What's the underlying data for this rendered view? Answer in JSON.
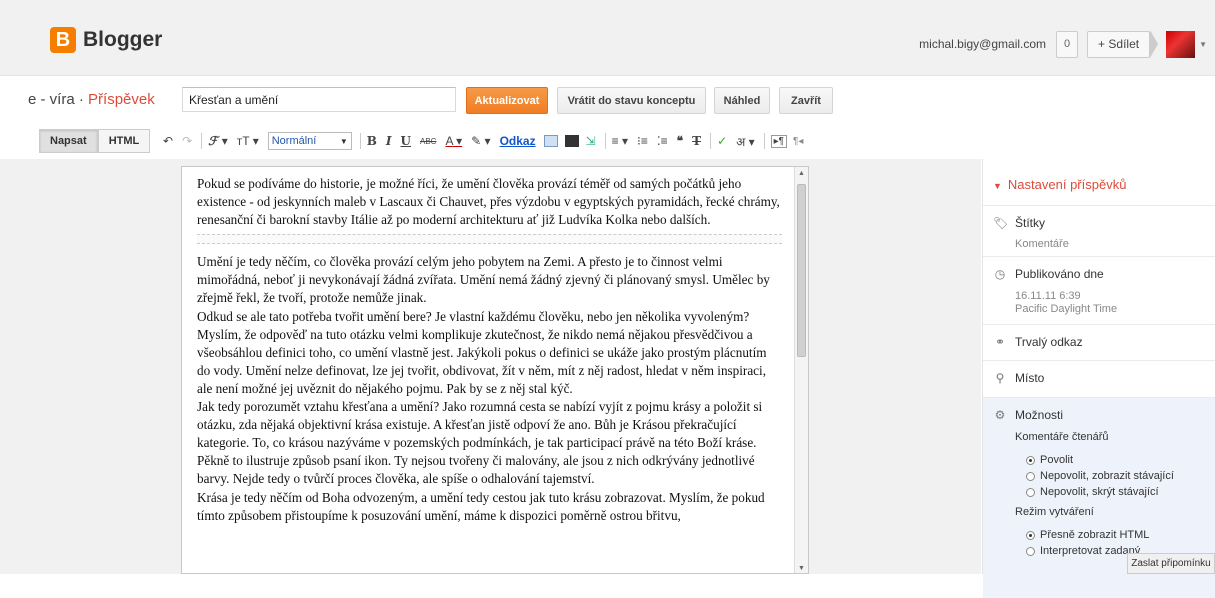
{
  "app": {
    "name": "Blogger",
    "logo_letter": "B",
    "brand_color": "#f57d00"
  },
  "account": {
    "email": "michal.bigy@gmail.com",
    "count": "0",
    "share_label": "+ Sdílet"
  },
  "titlebar": {
    "blog_name": "e - víra",
    "separator": "·",
    "section": "Příspěvek",
    "post_title": "Křesťan a umění",
    "publish_label": "Aktualizovat",
    "draft_label": "Vrátit do stavu konceptu",
    "preview_label": "Náhled",
    "close_label": "Zavřít"
  },
  "toolbar": {
    "compose_label": "Napsat",
    "html_label": "HTML",
    "font_size_value": "Normální",
    "link_label": "Odkaz"
  },
  "editor": {
    "intro": "Pokud se podíváme do historie, je možné říci, že umění člověka provází téměř od samých počátků jeho existence - od jeskynních maleb v Lascaux či Chauvet, přes výzdobu v egyptských pyramidách, řecké chrámy, renesanční či barokní stavby Itálie až po moderní architekturu ať již Ludvíka Kolka nebo dalších.",
    "p1": "Umění je tedy něčím, co člověka provází celým jeho pobytem na Zemi. A přesto je to činnost velmi mimořádná, neboť ji nevykonávají žádná zvířata. Umění nemá žádný zjevný či plánovaný smysl. Umělec by zřejmě řekl, že tvoří, protože nemůže jinak.",
    "p2": "Odkud se ale tato potřeba tvořit umění bere? Je vlastní každému člověku, nebo jen několika vyvoleným? Myslím, že odpověď na tuto otázku velmi komplikuje zkutečnost, že nikdo nemá nějakou přesvědčivou a všeobsáhlou definici toho, co umění vlastně jest. Jakýkoli pokus o definici se ukáže jako prostým plácnutím do vody. Umění nelze definovat, lze jej tvořit, obdivovat, žít v něm, mít z něj radost, hledat v něm inspiraci, ale není možné jej uvěznit do nějakého pojmu. Pak by se z něj stal kýč.",
    "p3": "Jak tedy porozumět vztahu křesťana a umění? Jako rozumná cesta se nabízí vyjít z pojmu krásy a položit si otázku, zda nějaká objektivní krása existuje. A křesťan jistě odpoví že ano. Bůh je Krásou překračující kategorie. To, co krásou nazýváme v pozemských podmínkách, je tak participací právě na této Boží kráse. Pěkně to ilustruje způsob psaní ikon. Ty nejsou tvořeny či malovány, ale jsou z nich odkrývány jednotlivé barvy. Nejde tedy o tvůrčí proces člověka, ale spíše o odhalování tajemství.",
    "p4": "Krása je tedy něčím od Boha odvozeným, a umění tedy cestou jak tuto krásu zobrazovat. Myslím, že pokud tímto způsobem přistoupíme k posuzování umění, máme k dispozici poměrně ostrou břitvu,"
  },
  "sidebar": {
    "heading": "Nastavení příspěvků",
    "labels_title": "Štítky",
    "labels_value": "Komentáře",
    "published_title": "Publikováno dne",
    "published_date": "16.11.11 6:39",
    "published_tz": "Pacific Daylight Time",
    "permalink_title": "Trvalý odkaz",
    "location_title": "Místo",
    "options_title": "Možnosti",
    "reader_comments": "Komentáře čtenářů",
    "comment_options": [
      "Povolit",
      "Nepovolit, zobrazit stávající",
      "Nepovolit, skrýt stávající"
    ],
    "compose_mode": "Režim vytváření",
    "compose_options": [
      "Přesně zobrazit HTML",
      "Interpretovat zadaný"
    ]
  },
  "feedback_label": "Zaslat připomínku"
}
